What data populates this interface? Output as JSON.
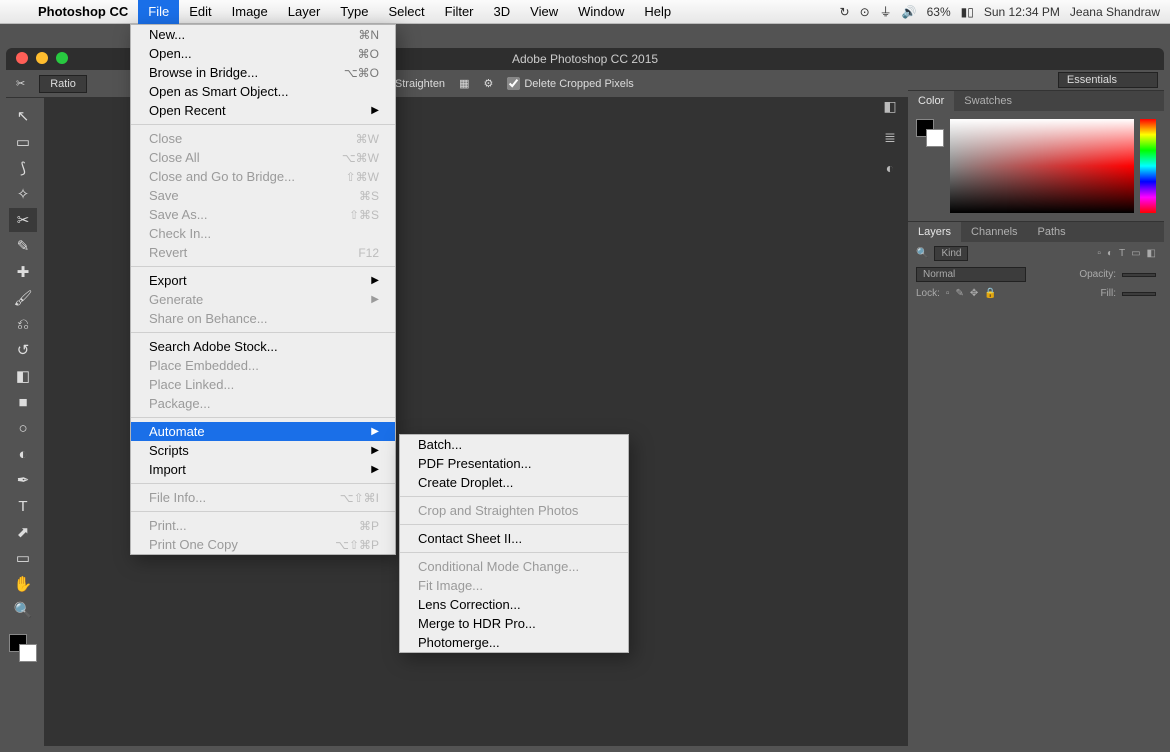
{
  "menubar": {
    "app": "Photoshop CC",
    "items": [
      "File",
      "Edit",
      "Image",
      "Layer",
      "Type",
      "Select",
      "Filter",
      "3D",
      "View",
      "Window",
      "Help"
    ],
    "active": "File",
    "status": {
      "battery": "63%",
      "clock": "Sun 12:34 PM",
      "user": "Jeana Shandraw"
    }
  },
  "window_title": "Adobe Photoshop CC 2015",
  "options_bar": {
    "crop_tool_glyph": "✂",
    "ratio_label": "Ratio",
    "straighten": "Straighten",
    "delete_cropped": "Delete Cropped Pixels",
    "workspace": "Essentials"
  },
  "tools": [
    {
      "name": "move",
      "glyph": "↖"
    },
    {
      "name": "marquee",
      "glyph": "▭"
    },
    {
      "name": "lasso",
      "glyph": "⟆"
    },
    {
      "name": "magic-wand",
      "glyph": "✧"
    },
    {
      "name": "crop",
      "glyph": "✂",
      "active": true
    },
    {
      "name": "eyedropper",
      "glyph": "✎"
    },
    {
      "name": "spot-heal",
      "glyph": "✚"
    },
    {
      "name": "brush",
      "glyph": "🖌"
    },
    {
      "name": "clone",
      "glyph": "⎌"
    },
    {
      "name": "history-brush",
      "glyph": "↺"
    },
    {
      "name": "eraser",
      "glyph": "◧"
    },
    {
      "name": "gradient",
      "glyph": "■"
    },
    {
      "name": "blur",
      "glyph": "○"
    },
    {
      "name": "dodge",
      "glyph": "◐"
    },
    {
      "name": "pen",
      "glyph": "✒"
    },
    {
      "name": "type",
      "glyph": "T"
    },
    {
      "name": "path",
      "glyph": "⬈"
    },
    {
      "name": "shape",
      "glyph": "▭"
    },
    {
      "name": "hand",
      "glyph": "✋"
    },
    {
      "name": "zoom",
      "glyph": "🔍"
    }
  ],
  "panels": {
    "color_tabs": [
      "Color",
      "Swatches"
    ],
    "layers_tabs": [
      "Layers",
      "Channels",
      "Paths"
    ],
    "layers": {
      "kind": "Kind",
      "blend": "Normal",
      "opacity_label": "Opacity:",
      "lock_label": "Lock:",
      "fill_label": "Fill:"
    }
  },
  "file_menu": [
    {
      "label": "New...",
      "sc": "⌘N"
    },
    {
      "label": "Open...",
      "sc": "⌘O"
    },
    {
      "label": "Browse in Bridge...",
      "sc": "⌥⌘O"
    },
    {
      "label": "Open as Smart Object..."
    },
    {
      "label": "Open Recent",
      "submenu": true
    },
    {
      "sep": true
    },
    {
      "label": "Close",
      "sc": "⌘W",
      "disabled": true
    },
    {
      "label": "Close All",
      "sc": "⌥⌘W",
      "disabled": true
    },
    {
      "label": "Close and Go to Bridge...",
      "sc": "⇧⌘W",
      "disabled": true
    },
    {
      "label": "Save",
      "sc": "⌘S",
      "disabled": true
    },
    {
      "label": "Save As...",
      "sc": "⇧⌘S",
      "disabled": true
    },
    {
      "label": "Check In...",
      "disabled": true
    },
    {
      "label": "Revert",
      "sc": "F12",
      "disabled": true
    },
    {
      "sep": true
    },
    {
      "label": "Export",
      "submenu": true
    },
    {
      "label": "Generate",
      "submenu": true,
      "disabled": true
    },
    {
      "label": "Share on Behance...",
      "disabled": true
    },
    {
      "sep": true
    },
    {
      "label": "Search Adobe Stock..."
    },
    {
      "label": "Place Embedded...",
      "disabled": true
    },
    {
      "label": "Place Linked...",
      "disabled": true
    },
    {
      "label": "Package...",
      "disabled": true
    },
    {
      "sep": true
    },
    {
      "label": "Automate",
      "submenu": true,
      "highlight": true
    },
    {
      "label": "Scripts",
      "submenu": true
    },
    {
      "label": "Import",
      "submenu": true
    },
    {
      "sep": true
    },
    {
      "label": "File Info...",
      "sc": "⌥⇧⌘I",
      "disabled": true
    },
    {
      "sep": true
    },
    {
      "label": "Print...",
      "sc": "⌘P",
      "disabled": true
    },
    {
      "label": "Print One Copy",
      "sc": "⌥⇧⌘P",
      "disabled": true
    }
  ],
  "automate_menu": [
    {
      "label": "Batch..."
    },
    {
      "label": "PDF Presentation..."
    },
    {
      "label": "Create Droplet..."
    },
    {
      "sep": true
    },
    {
      "label": "Crop and Straighten Photos",
      "disabled": true
    },
    {
      "sep": true
    },
    {
      "label": "Contact Sheet II..."
    },
    {
      "sep": true
    },
    {
      "label": "Conditional Mode Change...",
      "disabled": true
    },
    {
      "label": "Fit Image...",
      "disabled": true
    },
    {
      "label": "Lens Correction..."
    },
    {
      "label": "Merge to HDR Pro..."
    },
    {
      "label": "Photomerge..."
    }
  ]
}
